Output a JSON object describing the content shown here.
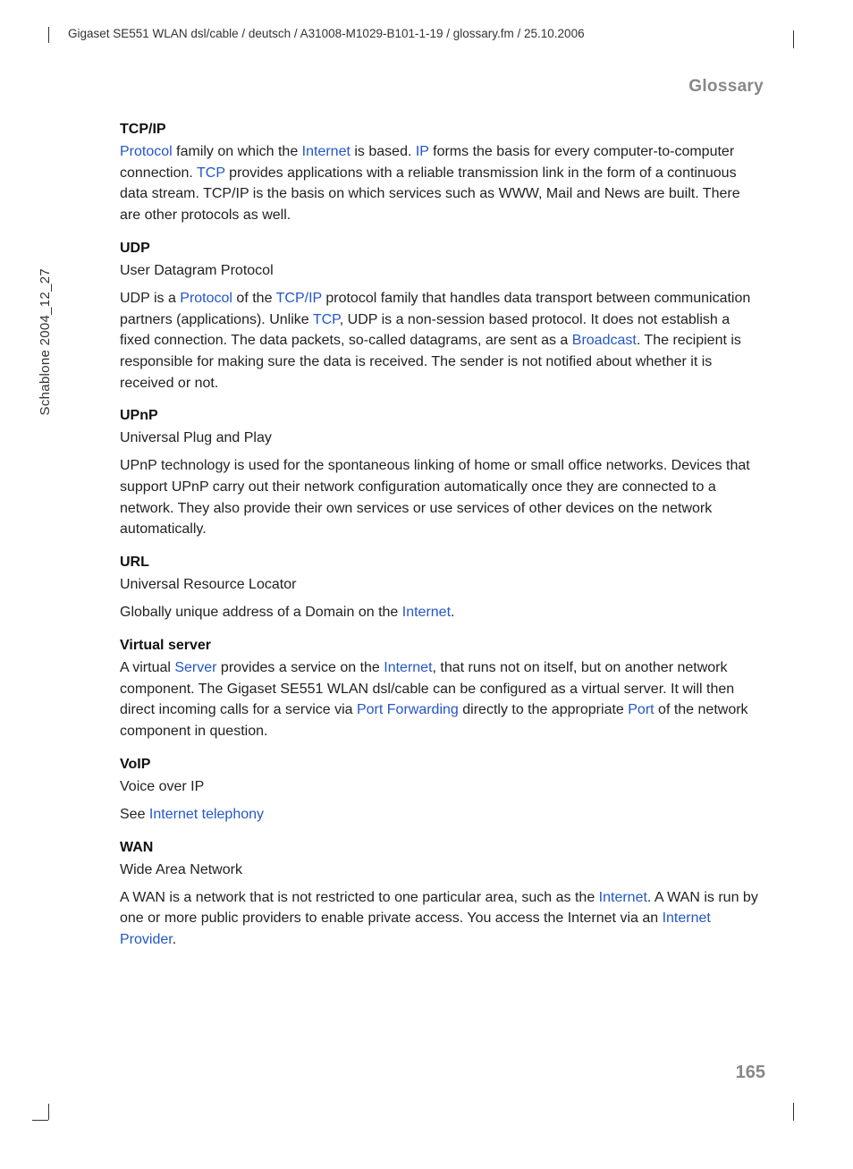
{
  "header_path": "Gigaset SE551 WLAN dsl/cable / deutsch / A31008-M1029-B101-1-19 / glossary.fm / 25.10.2006",
  "sidebar_text": "Schablone 2004_12_27",
  "section_title": "Glossary",
  "page_number": "165",
  "entries": {
    "tcpip": {
      "term": "TCP/IP",
      "p1a": "Protocol",
      "p1b": " family on which the ",
      "p1c": "Internet",
      "p1d": " is based. ",
      "p1e": "IP",
      "p1f": " forms the basis for every computer-to-computer connection. ",
      "p1g": "TCP",
      "p1h": " provides applications with a reliable transmission link in the form of a continuous data stream. TCP/IP is the basis on which services such as WWW, Mail and News are built. There are other protocols as well."
    },
    "udp": {
      "term": "UDP",
      "sub": "User Datagram Protocol",
      "p1a": "UDP is a ",
      "p1b": "Protocol",
      "p1c": " of the ",
      "p1d": "TCP/IP",
      "p1e": " protocol family that handles data transport between communication partners (applications). Unlike ",
      "p1f": "TCP",
      "p1g": ", UDP is a non-session based protocol. It does not establish a fixed connection. The data packets, so-called datagrams, are sent as a ",
      "p1h": "Broadcast",
      "p1i": ". The recipient is responsible for making sure the data is received. The sender is not notified about whether it is received or not."
    },
    "upnp": {
      "term": "UPnP",
      "sub": "Universal Plug and Play",
      "p1": "UPnP technology is used for the spontaneous linking of home or small office networks. Devices that support UPnP carry out their network configuration automatically once they are connected to a network. They also provide their own services or use services of other devices on the network automatically."
    },
    "url": {
      "term": "URL",
      "sub": "Universal Resource Locator",
      "p1a": "Globally unique address of a Domain on the ",
      "p1b": "Internet",
      "p1c": "."
    },
    "vserver": {
      "term": "Virtual server",
      "p1a": "A virtual ",
      "p1b": "Server",
      "p1c": " provides a service on the ",
      "p1d": "Internet",
      "p1e": ", that runs not on itself, but on another network component. The Gigaset SE551 WLAN dsl/cable can be configured as a virtual server. It will then direct incoming calls for a service via ",
      "p1f": "Port Forwarding",
      "p1g": " directly to the appropriate ",
      "p1h": "Port",
      "p1i": " of the network component in question."
    },
    "voip": {
      "term": "VoIP",
      "sub": "Voice over IP",
      "p1a": "See ",
      "p1b": "Internet telephony"
    },
    "wan": {
      "term": "WAN",
      "sub": "Wide Area Network",
      "p1a": "A WAN is a network that is not restricted to one particular area, such as the ",
      "p1b": "Internet",
      "p1c": ". A WAN is run by one or more public providers to enable private access. You access the Internet via an ",
      "p1d": "Internet Provider",
      "p1e": "."
    }
  }
}
